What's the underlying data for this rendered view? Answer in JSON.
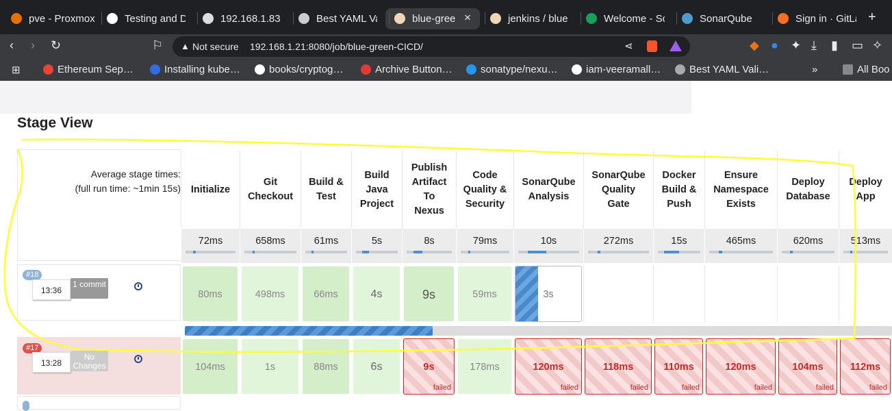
{
  "tabs": [
    {
      "title": "pve - Proxmox",
      "icon": "proxmox-icon"
    },
    {
      "title": "Testing and D",
      "icon": "openai-icon"
    },
    {
      "title": "192.168.1.83",
      "icon": "globe-icon"
    },
    {
      "title": "Best YAML Va",
      "icon": "jf-icon"
    },
    {
      "title": "blue-gree",
      "icon": "jenkins-icon",
      "active": true
    },
    {
      "title": "jenkins / blue",
      "icon": "jenkins-icon"
    },
    {
      "title": "Welcome - Sc",
      "icon": "check-icon"
    },
    {
      "title": "SonarQube",
      "icon": "sonarqube-icon"
    },
    {
      "title": "Sign in · GitLa",
      "icon": "gitlab-icon"
    }
  ],
  "address": {
    "security": "Not secure",
    "url": "192.168.1.21:8080/job/blue-green-CICD/"
  },
  "bookmarks": [
    {
      "title": "Ethereum Sep…",
      "icon": "google-icon"
    },
    {
      "title": "Installing kube…",
      "icon": "kubernetes-icon"
    },
    {
      "title": "books/cryptog…",
      "icon": "github-icon"
    },
    {
      "title": "Archive Button…",
      "icon": "ab-icon"
    },
    {
      "title": "sonatype/nexu…",
      "icon": "docker-icon"
    },
    {
      "title": "iam-veeramall…",
      "icon": "github-icon"
    },
    {
      "title": "Best YAML Vali…",
      "icon": "jf-icon"
    }
  ],
  "bookmarks_more": "»",
  "bookmarks_all": "All Boo",
  "stage_view": {
    "title": "Stage View",
    "avg_label_1": "Average stage times:",
    "avg_label_2": "(full run time: ~1min 15s)",
    "stages": [
      {
        "name": "Initialize",
        "avg": "72ms",
        "progress": 0.05
      },
      {
        "name": "Git Checkout",
        "avg": "658ms",
        "progress": 0.05
      },
      {
        "name": "Build & Test",
        "avg": "61ms",
        "progress": 0.05
      },
      {
        "name": "Build Java Project",
        "avg": "5s",
        "progress": 0.15
      },
      {
        "name": "Publish Artifact To Nexus",
        "avg": "8s",
        "progress": 0.2
      },
      {
        "name": "Code Quality & Security",
        "avg": "79ms",
        "progress": 0.05
      },
      {
        "name": "SonarQube Analysis",
        "avg": "10s",
        "progress": 0.3
      },
      {
        "name": "SonarQube Quality Gate",
        "avg": "272ms",
        "progress": 0.05
      },
      {
        "name": "Docker Build & Push",
        "avg": "15s",
        "progress": 0.35
      },
      {
        "name": "Ensure Namespace Exists",
        "avg": "465ms",
        "progress": 0.05
      },
      {
        "name": "Deploy Database",
        "avg": "620ms",
        "progress": 0.05
      },
      {
        "name": "Deploy App",
        "avg": "513ms",
        "progress": 0.05
      }
    ],
    "builds": [
      {
        "number": "#18",
        "time": "13:36",
        "changes": "1 commit",
        "status": "running",
        "progress": 0.35,
        "cells": [
          {
            "value": "80ms",
            "state": "success"
          },
          {
            "value": "498ms",
            "state": "success"
          },
          {
            "value": "66ms",
            "state": "success"
          },
          {
            "value": "4s",
            "state": "success"
          },
          {
            "value": "9s",
            "state": "success"
          },
          {
            "value": "59ms",
            "state": "success"
          },
          {
            "value": "3s",
            "state": "running"
          },
          {
            "value": "",
            "state": "empty"
          },
          {
            "value": "",
            "state": "empty"
          },
          {
            "value": "",
            "state": "empty"
          },
          {
            "value": "",
            "state": "empty"
          },
          {
            "value": "",
            "state": "empty"
          }
        ]
      },
      {
        "number": "#17",
        "time": "13:28",
        "changes": "No Changes",
        "status": "failed",
        "cells": [
          {
            "value": "104ms",
            "state": "success"
          },
          {
            "value": "1s",
            "state": "success"
          },
          {
            "value": "88ms",
            "state": "success"
          },
          {
            "value": "6s",
            "state": "success"
          },
          {
            "value": "9s",
            "state": "failed",
            "label": "failed"
          },
          {
            "value": "178ms",
            "state": "success"
          },
          {
            "value": "120ms",
            "state": "failed",
            "label": "failed"
          },
          {
            "value": "118ms",
            "state": "failed",
            "label": "failed"
          },
          {
            "value": "110ms",
            "state": "failed",
            "label": "failed"
          },
          {
            "value": "120ms",
            "state": "failed",
            "label": "failed"
          },
          {
            "value": "104ms",
            "state": "failed",
            "label": "failed"
          },
          {
            "value": "112ms",
            "state": "failed",
            "label": "failed"
          }
        ]
      }
    ]
  },
  "colors": {
    "success": "#e0f5d9",
    "failed": "#c62828",
    "running": "#4a88cc",
    "annotation": "#ffff33"
  }
}
